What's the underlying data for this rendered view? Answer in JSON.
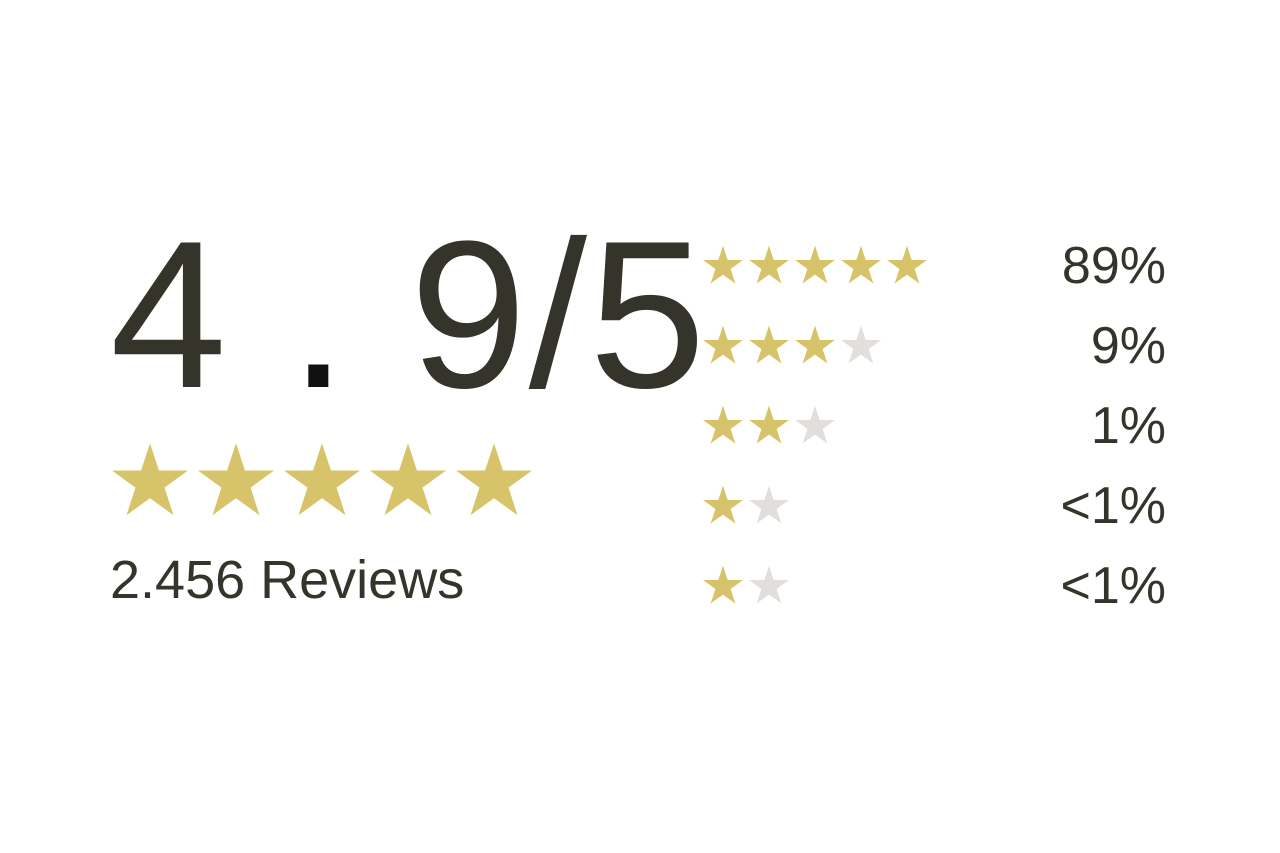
{
  "summary": {
    "score_whole": "4",
    "score_dot": ".",
    "score_rest": "9/5",
    "rating_value": 4.9,
    "rating_max": 5,
    "filled_stars": 5,
    "review_count_text": "2.456 Reviews"
  },
  "breakdown": [
    {
      "stars_filled": 5,
      "stars_empty": 0,
      "percent": "89%"
    },
    {
      "stars_filled": 3,
      "stars_empty": 1,
      "percent": "9%"
    },
    {
      "stars_filled": 2,
      "stars_empty": 1,
      "percent": "1%"
    },
    {
      "stars_filled": 1,
      "stars_empty": 1,
      "percent": "<1%"
    },
    {
      "stars_filled": 1,
      "stars_empty": 1,
      "percent": "<1%"
    }
  ],
  "colors": {
    "star_filled": "#d7c46a",
    "star_empty": "#e2dfdb",
    "text": "#34342b"
  },
  "icons": {
    "filled_star": "star-filled-icon",
    "empty_star": "star-empty-icon"
  }
}
